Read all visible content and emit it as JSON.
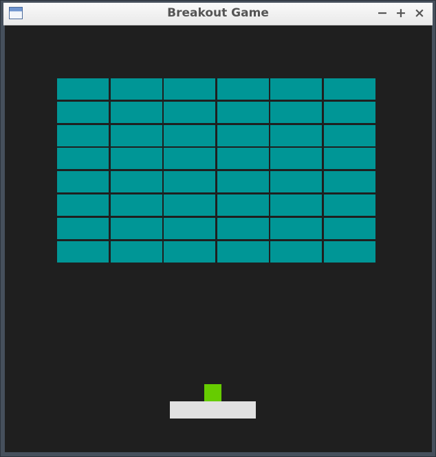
{
  "window": {
    "title": "Breakout Game",
    "controls": {
      "minimize": "−",
      "maximize": "+",
      "close": "×"
    }
  },
  "game": {
    "background": "#1f1f1f",
    "bricks": {
      "rows": 8,
      "columns": 6,
      "color": "#009696"
    },
    "ball": {
      "color": "#66cc00"
    },
    "paddle": {
      "color": "#e1e1e1"
    }
  },
  "icons": {
    "app": "window-app-icon"
  }
}
